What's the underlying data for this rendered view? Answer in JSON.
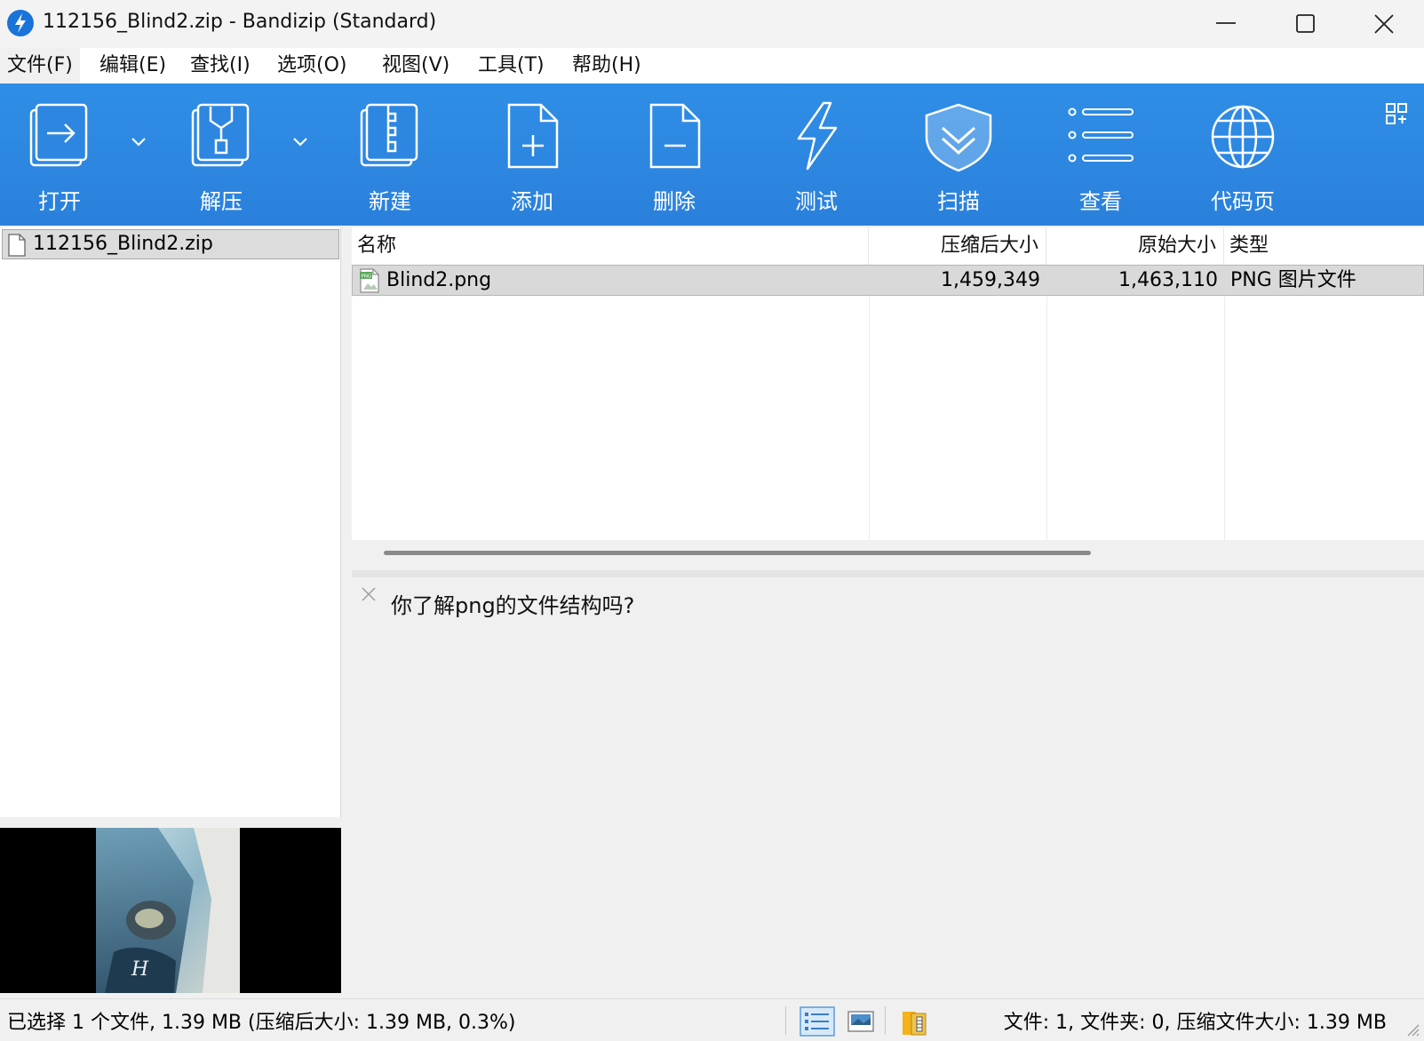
{
  "window": {
    "title": "112156_Blind2.zip - Bandizip (Standard)"
  },
  "menu": {
    "items": [
      {
        "label": "文件(F)"
      },
      {
        "label": "编辑(E)"
      },
      {
        "label": "查找(I)"
      },
      {
        "label": "选项(O)"
      },
      {
        "label": "视图(V)"
      },
      {
        "label": "工具(T)"
      },
      {
        "label": "帮助(H)"
      }
    ]
  },
  "toolbar": {
    "open": "打开",
    "extract": "解压",
    "new": "新建",
    "add": "添加",
    "delete": "删除",
    "test": "测试",
    "scan": "扫描",
    "view": "查看",
    "codepage": "代码页"
  },
  "tree": {
    "archive": "112156_Blind2.zip"
  },
  "file_list": {
    "columns": {
      "name": "名称",
      "compressed": "压缩后大小",
      "original": "原始大小",
      "type": "类型"
    },
    "rows": [
      {
        "name": "Blind2.png",
        "compressed": "1,459,349",
        "original": "1,463,110",
        "type": "PNG 图片文件",
        "icon_label": "PNG"
      }
    ]
  },
  "comment": {
    "text": "你了解png的文件结构吗?"
  },
  "status": {
    "selection": "已选择 1 个文件, 1.39 MB (压缩后大小: 1.39 MB, 0.3%)",
    "summary": "文件: 1, 文件夹: 0, 压缩文件大小: 1.39 MB"
  },
  "colors": {
    "toolbar_blue": "#2d86e0",
    "selected_row": "#d9d9d9",
    "app_icon": "#1a73d9"
  },
  "icons": {
    "app": "bandizip-logo-icon",
    "open": "open-arrow-icon",
    "extract": "extract-zip-icon",
    "new": "new-zip-icon",
    "add": "add-file-icon",
    "delete": "delete-file-icon",
    "test": "lightning-icon",
    "scan": "shield-icon",
    "view": "list-icon",
    "codepage": "globe-icon"
  }
}
